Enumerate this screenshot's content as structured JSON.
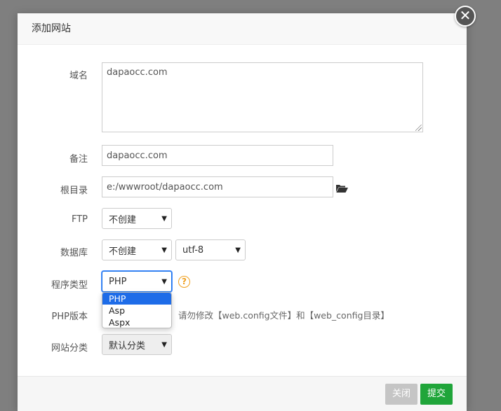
{
  "dialog": {
    "title": "添加网站",
    "close_glyph": "✕"
  },
  "form": {
    "domain": {
      "label": "域名",
      "value": "dapaocc.com"
    },
    "remark": {
      "label": "备注",
      "value": "dapaocc.com"
    },
    "root_dir": {
      "label": "根目录",
      "value": "e:/wwwroot/dapaocc.com",
      "icon": "folder-open-icon"
    },
    "ftp": {
      "label": "FTP",
      "selected": "不创建"
    },
    "database": {
      "label": "数据库",
      "selected": "不创建",
      "charset": "utf-8"
    },
    "program_type": {
      "label": "程序类型",
      "selected": "PHP",
      "help_glyph": "?",
      "options": [
        "PHP",
        "Asp",
        "Aspx"
      ]
    },
    "php_version": {
      "label": "PHP版本",
      "hint": "请勿修改【web.config文件】和【web_config目录】"
    },
    "site_category": {
      "label": "网站分类",
      "selected": "默认分类"
    }
  },
  "footer": {
    "close_label": "关闭",
    "submit_label": "提交"
  },
  "colors": {
    "submit": "#20a53a",
    "close": "#c5c5c5",
    "help": "#f0a020",
    "dropdown_selected": "#1e6ce8"
  }
}
